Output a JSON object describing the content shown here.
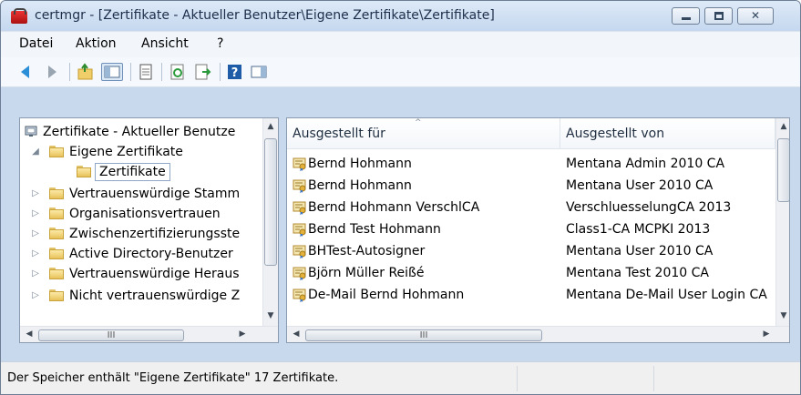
{
  "window": {
    "title": "certmgr - [Zertifikate - Aktueller Benutzer\\Eigene Zertifikate\\Zertifikate]",
    "app_icon": "certmgr-icon"
  },
  "menubar": {
    "items": [
      {
        "label": "Datei"
      },
      {
        "label": "Aktion"
      },
      {
        "label": "Ansicht"
      },
      {
        "label": "?"
      }
    ]
  },
  "toolbar": {
    "buttons": [
      "back-icon",
      "forward-icon",
      "up-folder-icon",
      "show-hide-tree-icon",
      "properties-icon",
      "refresh-icon",
      "export-list-icon",
      "help-icon",
      "action-pane-icon"
    ]
  },
  "tree": {
    "items": [
      {
        "label": "Zertifikate - Aktueller Benutze",
        "expander": ""
      },
      {
        "label": "Eigene Zertifikate",
        "expander": "◢"
      },
      {
        "label": "Zertifikate",
        "expander": ""
      },
      {
        "label": "Vertrauenswürdige Stamm",
        "expander": "▷"
      },
      {
        "label": "Organisationsvertrauen",
        "expander": "▷"
      },
      {
        "label": "Zwischenzertifizierungsste",
        "expander": "▷"
      },
      {
        "label": "Active Directory-Benutzer",
        "expander": "▷"
      },
      {
        "label": "Vertrauenswürdige Heraus",
        "expander": "▷"
      },
      {
        "label": "Nicht vertrauenswürdige Z",
        "expander": "▷"
      }
    ],
    "hscroll_thumb": "III"
  },
  "list": {
    "columns": [
      "Ausgestellt für",
      "Ausgestellt von"
    ],
    "sort_indicator": "^",
    "rows": [
      {
        "issued_to": "Bernd Hohmann",
        "issued_by": "Mentana Admin 2010 CA"
      },
      {
        "issued_to": "Bernd Hohmann",
        "issued_by": "Mentana User 2010 CA"
      },
      {
        "issued_to": "Bernd Hohmann VerschlCA",
        "issued_by": "VerschluesselungCA 2013"
      },
      {
        "issued_to": "Bernd Test Hohmann",
        "issued_by": "Class1-CA MCPKI 2013"
      },
      {
        "issued_to": "BHTest-Autosigner",
        "issued_by": "Mentana User 2010 CA"
      },
      {
        "issued_to": "Björn Müller Reißé",
        "issued_by": "Mentana Test 2010 CA"
      },
      {
        "issued_to": "De-Mail Bernd Hohmann",
        "issued_by": "Mentana De-Mail User Login CA"
      }
    ],
    "hscroll_thumb": "III"
  },
  "statusbar": {
    "text": "Der Speicher enthält \"Eigene Zertifikate\" 17 Zertifikate."
  },
  "colors": {
    "frame": "#c8d9ee",
    "accent_arrow": "#2b8fd8",
    "folder": "#e8c25a"
  }
}
